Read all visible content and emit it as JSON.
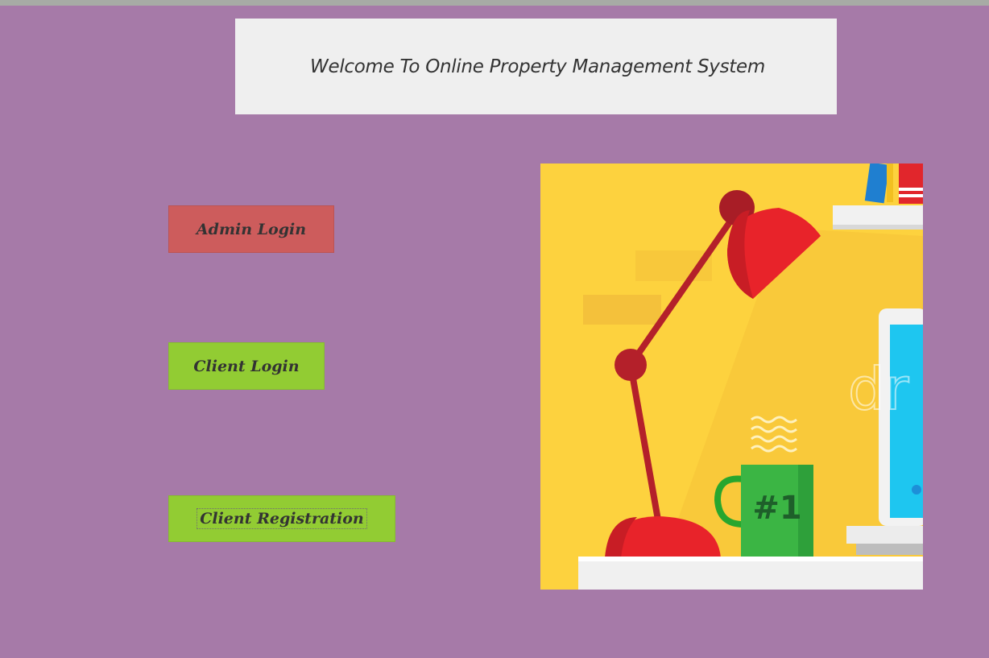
{
  "header": {
    "title": "Welcome To Online Property Management System"
  },
  "buttons": {
    "admin_login": "Admin Login",
    "client_login": "Client Login",
    "client_registration": "Client Registration"
  },
  "illustration": {
    "mug_label": "#1",
    "watermark": "dr"
  },
  "colors": {
    "background": "#a67aa8",
    "title_panel": "#efefef",
    "admin_button": "#cd5c5c",
    "client_button": "#92cc33"
  }
}
